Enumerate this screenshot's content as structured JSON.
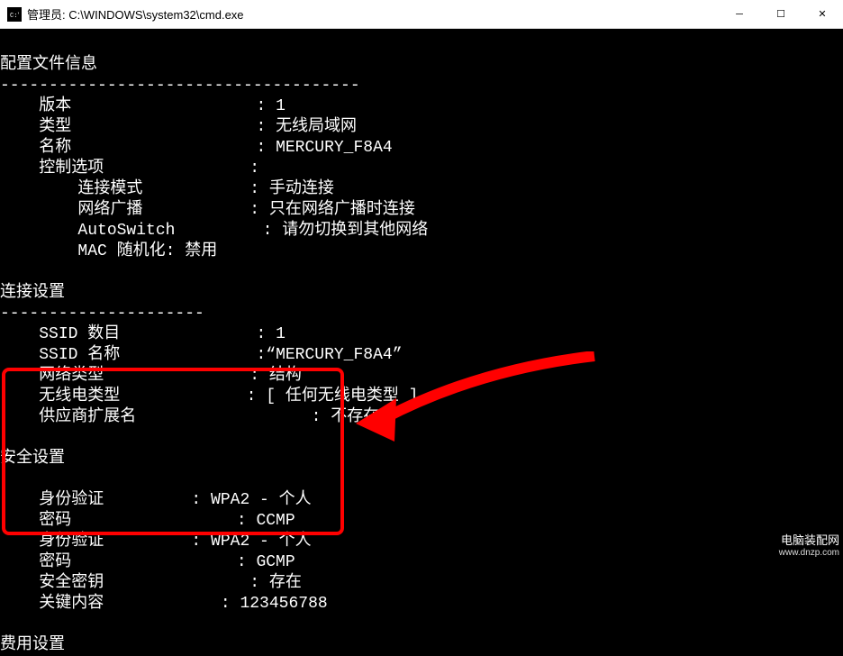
{
  "titlebar": {
    "title": "管理员: C:\\WINDOWS\\system32\\cmd.exe"
  },
  "sections": {
    "config": {
      "header": "配置文件信息",
      "divider": "-------------------------------------",
      "version_lbl": "版本",
      "version_val": "1",
      "type_lbl": "类型",
      "type_val": "无线局域网",
      "name_lbl": "名称",
      "name_val": "MERCURY_F8A4",
      "ctrlopt_lbl": "控制选项",
      "connmode_lbl": "连接模式",
      "connmode_val": "手动连接",
      "netbcast_lbl": "网络广播",
      "netbcast_val": "只在网络广播时连接",
      "autoswitch_lbl": "AutoSwitch",
      "autoswitch_val": "请勿切换到其他网络",
      "macrand_lbl": "MAC 随机化: 禁用"
    },
    "connect": {
      "header": "连接设置",
      "divider": "---------------------",
      "ssidnum_lbl": "SSID 数目",
      "ssidnum_val": "1",
      "ssidname_lbl": "SSID 名称",
      "ssidname_val": "“MERCURY_F8A4”",
      "nettype_lbl": "网络类型",
      "nettype_val": "结构",
      "radiotype_lbl": "无线电类型",
      "radiotype_val": "[ 任何无线电类型 ]",
      "vendor_lbl": "供应商扩展名",
      "vendor_val": "不存在"
    },
    "security": {
      "header": "安全设置",
      "auth1_lbl": "身份验证",
      "auth1_val": "WPA2 - 个人",
      "cipher1_lbl": "密码",
      "cipher1_val": "CCMP",
      "auth2_lbl": "身份验证",
      "auth2_val": "WPA2 - 个人",
      "cipher2_lbl": "密码",
      "cipher2_val": "GCMP",
      "seckey_lbl": "安全密钥",
      "seckey_val": "存在",
      "keycontent_lbl": "关键内容",
      "keycontent_val": "123456788"
    },
    "cost": {
      "header": "费用设置"
    }
  },
  "watermark": {
    "name": "电脑装配网",
    "url": "www.dnzp.com"
  }
}
